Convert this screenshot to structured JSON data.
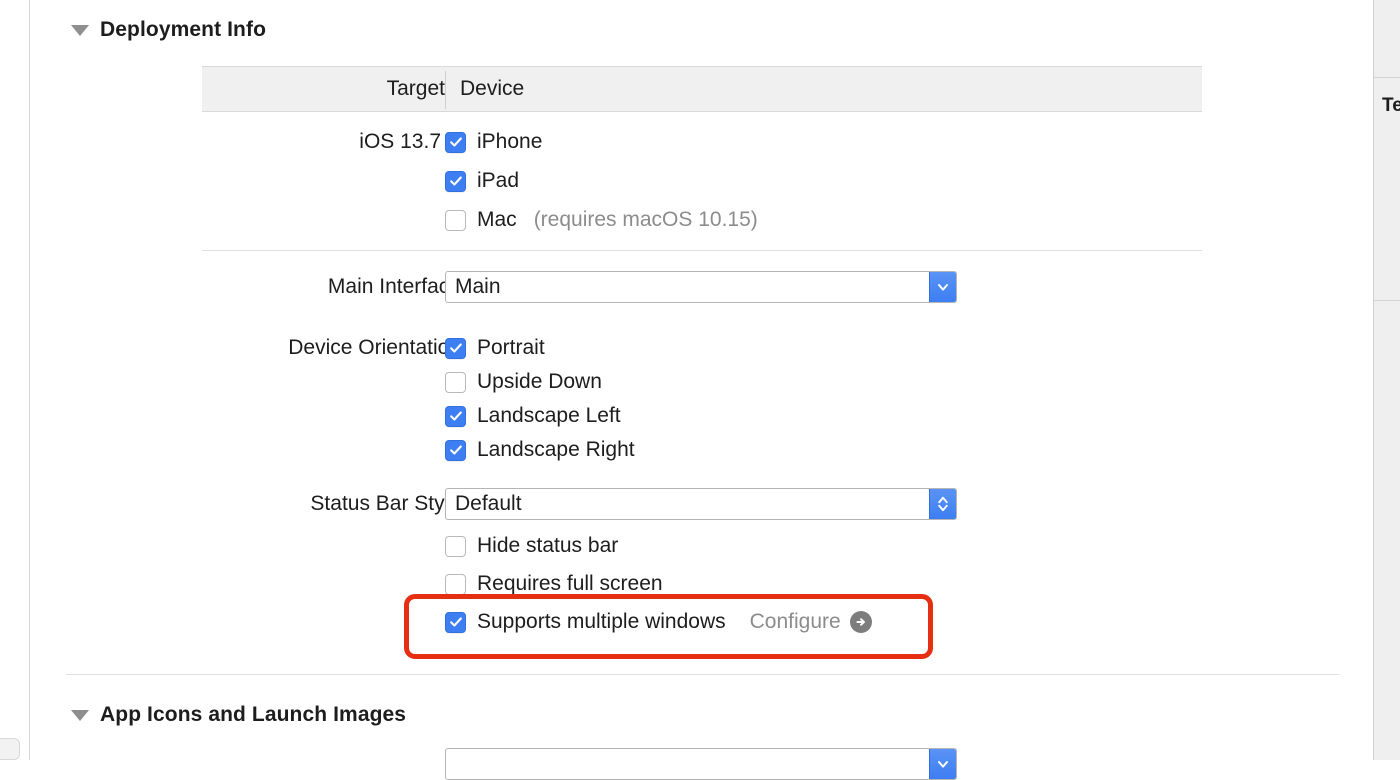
{
  "window": {
    "inspector_panel_heading": "Te"
  },
  "sections": [
    {
      "title": "Deployment Info",
      "disclosure": "triangle-down-icon"
    },
    {
      "title": "App Icons and Launch Images",
      "disclosure": "triangle-down-icon"
    }
  ],
  "deployment_info": {
    "table_header": {
      "target_column": "Target",
      "device_column": "Device"
    },
    "target_row": {
      "label": "iOS 13.7",
      "stepper_icon": "stepper-up-down-icon"
    },
    "devices": [
      {
        "label": "iPhone",
        "checked": true,
        "note": ""
      },
      {
        "label": "iPad",
        "checked": true,
        "note": ""
      },
      {
        "label": "Mac",
        "checked": false,
        "note": "(requires macOS 10.15)"
      }
    ],
    "main_interface": {
      "label": "Main Interface",
      "value": "Main",
      "button_icon": "chevron-down-icon"
    },
    "device_orientation": {
      "label": "Device Orientation",
      "options": [
        {
          "label": "Portrait",
          "checked": true
        },
        {
          "label": "Upside Down",
          "checked": false
        },
        {
          "label": "Landscape Left",
          "checked": true
        },
        {
          "label": "Landscape Right",
          "checked": true
        }
      ]
    },
    "status_bar_style": {
      "label": "Status Bar Style",
      "value": "Default",
      "button_icon": "chevron-up-down-icon"
    },
    "status_options": [
      {
        "label": "Hide status bar",
        "checked": false
      },
      {
        "label": "Requires full screen",
        "checked": false
      },
      {
        "label": "Supports multiple windows",
        "checked": true
      }
    ],
    "configure": {
      "label": "Configure",
      "icon": "arrow-right-circle-icon"
    }
  },
  "annotation": {
    "color": "#e62e13",
    "target": "Supports multiple windows"
  },
  "colors": {
    "checkbox_checked": "#3d7ef2",
    "popup_button": "#3d7ef2",
    "muted_text": "#8c8c8c",
    "header_background": "#f0f0f0",
    "annotation_red": "#e62e13"
  }
}
